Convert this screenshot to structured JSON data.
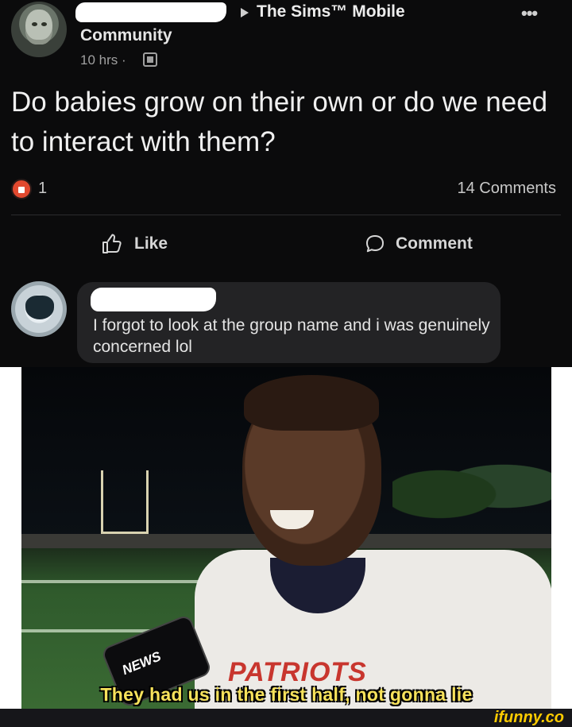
{
  "post": {
    "group_name": "The Sims™ Mobile",
    "sub_name": "Community",
    "time": "10 hrs ·",
    "text": "Do babies grow on their own or do we need to interact with them?",
    "reaction_count": "1",
    "comment_count": "14 Comments",
    "actions": {
      "like": "Like",
      "comment": "Comment"
    }
  },
  "comment": {
    "text": "I forgot to look at the group name and i was genuinely concerned lol"
  },
  "meme": {
    "subtitle": "They had us in the first half, not gonna lie",
    "mic_logo": "NEWS",
    "jersey": "PATRIOTS"
  },
  "footer": {
    "watermark": "ifunny.co"
  },
  "colors": {
    "background": "#0b0b0c",
    "bubble": "#232325",
    "reaction": "#e2492f",
    "subtitle": "#f7e25b",
    "watermark": "#ffcc00"
  },
  "icons": [
    "avatar",
    "arrow-right-icon",
    "more-icon",
    "group-icon",
    "angry-reaction-icon",
    "like-icon",
    "comment-icon"
  ]
}
